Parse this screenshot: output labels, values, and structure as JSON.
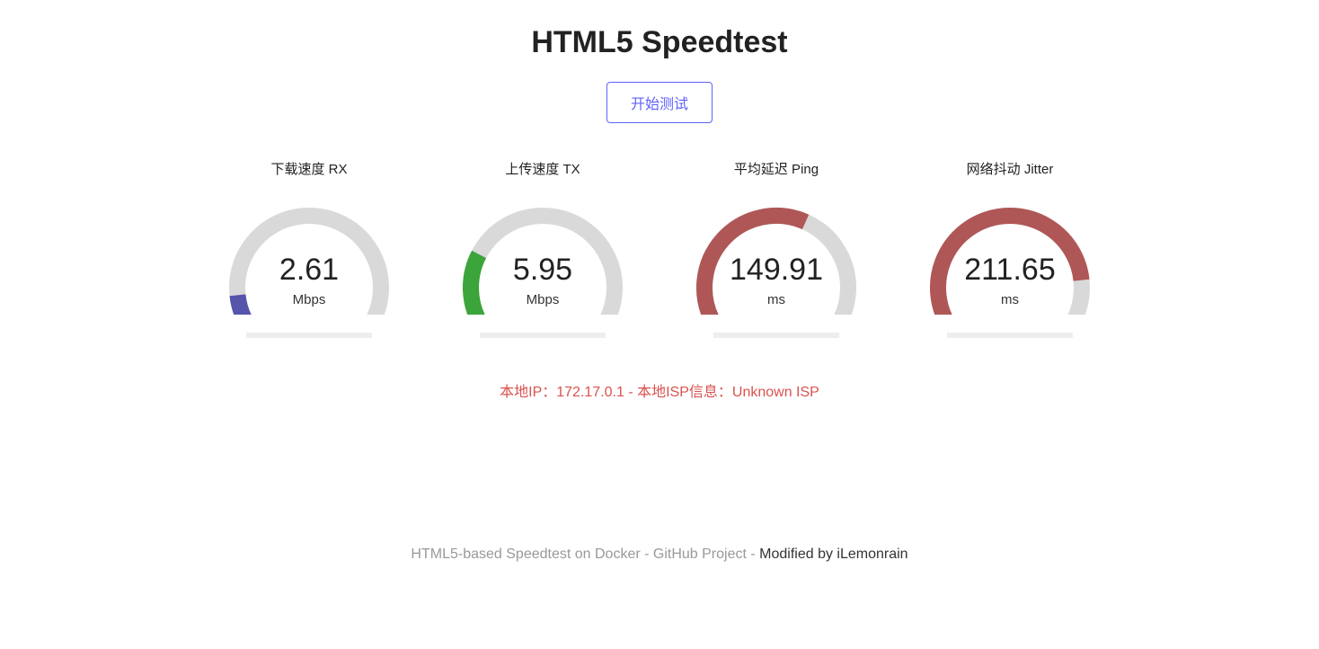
{
  "title": "HTML5 Speedtest",
  "start_label": "开始测试",
  "gauges": [
    {
      "label": "下载速度 RX",
      "value": "2.61",
      "unit": "Mbps",
      "color": "#5555AC",
      "fraction": 0.1
    },
    {
      "label": "上传速度 TX",
      "value": "5.95",
      "unit": "Mbps",
      "color": "#3BA43B",
      "fraction": 0.24
    },
    {
      "label": "平均延迟 Ping",
      "value": "149.91",
      "unit": "ms",
      "color": "#AF5757",
      "fraction": 0.6
    },
    {
      "label": "网络抖动 Jitter",
      "value": "211.65",
      "unit": "ms",
      "color": "#AF5757",
      "fraction": 0.85
    }
  ],
  "ip_line": "本地IP：172.17.0.1 - 本地ISP信息：Unknown ISP",
  "footer": {
    "link1": "HTML5-based Speedtest on Docker",
    "sep1": " - ",
    "link2": "GitHub Project",
    "sep2": " - ",
    "mod": "Modified by iLemonrain"
  },
  "chart_data": [
    {
      "type": "gauge",
      "title": "下载速度 RX",
      "value": 2.61,
      "unit": "Mbps",
      "fill_fraction": 0.1,
      "fill_color": "#5555AC"
    },
    {
      "type": "gauge",
      "title": "上传速度 TX",
      "value": 5.95,
      "unit": "Mbps",
      "fill_fraction": 0.24,
      "fill_color": "#3BA43B"
    },
    {
      "type": "gauge",
      "title": "平均延迟 Ping",
      "value": 149.91,
      "unit": "ms",
      "fill_fraction": 0.6,
      "fill_color": "#AF5757"
    },
    {
      "type": "gauge",
      "title": "网络抖动 Jitter",
      "value": 211.65,
      "unit": "ms",
      "fill_fraction": 0.85,
      "fill_color": "#AF5757"
    }
  ]
}
